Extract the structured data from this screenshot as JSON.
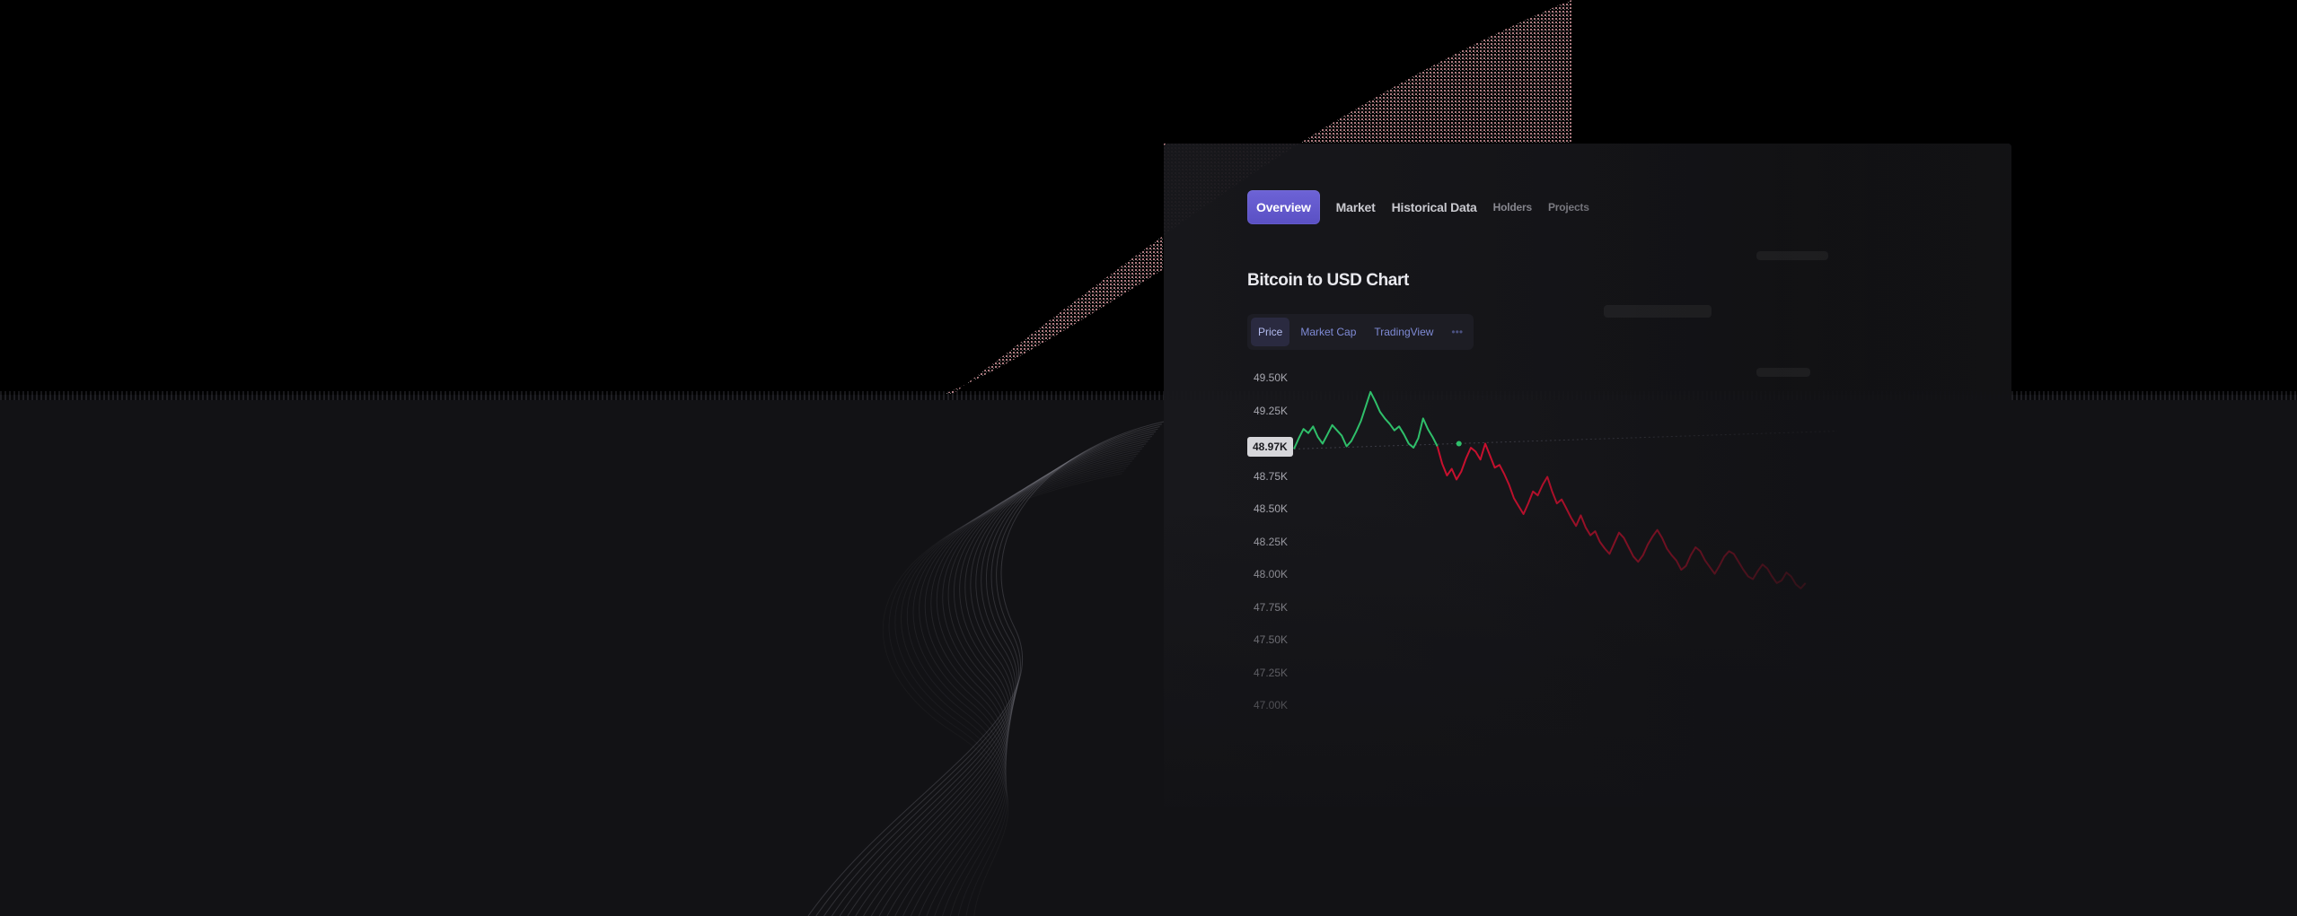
{
  "nav": {
    "tabs": [
      {
        "label": "Overview",
        "active": true
      },
      {
        "label": "Market",
        "active": false
      },
      {
        "label": "Historical Data",
        "active": false
      },
      {
        "label": "Holders",
        "active": false
      },
      {
        "label": "Projects",
        "active": false
      }
    ]
  },
  "chart": {
    "title": "Bitcoin to USD Chart",
    "view_options": [
      {
        "label": "Price",
        "selected": true
      },
      {
        "label": "Market Cap",
        "selected": false
      },
      {
        "label": "TradingView",
        "selected": false
      }
    ],
    "current_price_label": "48.97K"
  },
  "colors": {
    "accent": "#6258d0",
    "up": "#2fbf6a",
    "down": "#c8102e",
    "background": "#121215"
  },
  "chart_data": {
    "type": "line",
    "title": "Bitcoin to USD Chart",
    "xlabel": "",
    "ylabel": "",
    "y_ticks": [
      "49.50K",
      "49.25K",
      "48.97K",
      "48.75K",
      "48.50K",
      "48.25K",
      "48.00K",
      "47.75K",
      "47.50K",
      "47.25K",
      "47.00K"
    ],
    "ylim": [
      47000,
      49500
    ],
    "reference_value": 48970,
    "series": [
      {
        "color": "up",
        "values": [
          48970,
          49050,
          49120,
          49090,
          49140,
          49060,
          49010,
          49080,
          49150,
          49110,
          49070,
          48990,
          49030,
          49100,
          49180,
          49290,
          49400,
          49330,
          49250,
          49200,
          49160,
          49110,
          49140,
          49080,
          49010,
          48980,
          49050,
          49200,
          49120,
          49060,
          48990
        ]
      },
      {
        "color": "down",
        "values": [
          48990,
          48860,
          48770,
          48820,
          48740,
          48800,
          48900,
          48980,
          48950,
          48890,
          49010,
          48920,
          48830,
          48850,
          48780,
          48700,
          48600,
          48540,
          48480,
          48560,
          48650,
          48620,
          48700,
          48760,
          48650,
          48560,
          48590,
          48520,
          48450,
          48390,
          48470,
          48380,
          48320,
          48350,
          48270,
          48220,
          48180,
          48260,
          48340,
          48300,
          48230,
          48160,
          48120,
          48170,
          48250,
          48310,
          48360,
          48300,
          48220,
          48170,
          48130,
          48060,
          48090,
          48170,
          48230,
          48200,
          48130,
          48080,
          48030,
          48090,
          48160,
          48200,
          48180,
          48120,
          48060,
          48010,
          47990,
          48050,
          48100,
          48070,
          48010,
          47960,
          47980,
          48040,
          48010,
          47950,
          47920,
          47960
        ]
      }
    ],
    "grid": false,
    "legend": "none"
  }
}
